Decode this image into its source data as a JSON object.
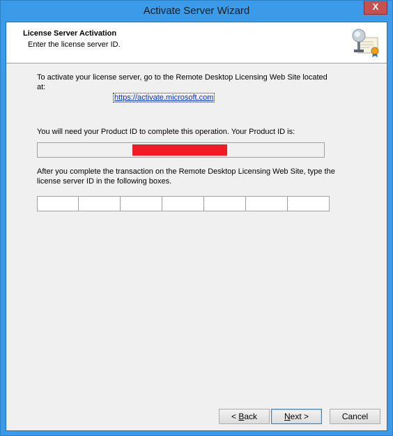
{
  "window": {
    "title": "Activate Server Wizard",
    "close_glyph": "X"
  },
  "header": {
    "title": "License Server Activation",
    "subtitle": "Enter the license server ID.",
    "icon": "license-certificate-icon"
  },
  "content": {
    "intro_text": "To activate your license server, go to the Remote Desktop Licensing Web Site located at:",
    "link": "https://activate.microsoft.com",
    "product_id_text": "You will need your Product ID to complete this operation. Your Product ID is:",
    "product_id_value": "",
    "instructions_text": "After you complete the transaction on the Remote Desktop Licensing Web Site, type the license server ID in the following boxes.",
    "license_id_fields": [
      "",
      "",
      "",
      "",
      "",
      "",
      ""
    ]
  },
  "buttons": {
    "back_prefix": "< ",
    "back_key": "B",
    "back_rest": "ack",
    "next_key": "N",
    "next_rest": "ext >",
    "cancel": "Cancel"
  },
  "colors": {
    "titlebar": "#3c9be8",
    "close_button": "#c75050",
    "redaction": "#ee1c25",
    "link": "#0033cc"
  }
}
